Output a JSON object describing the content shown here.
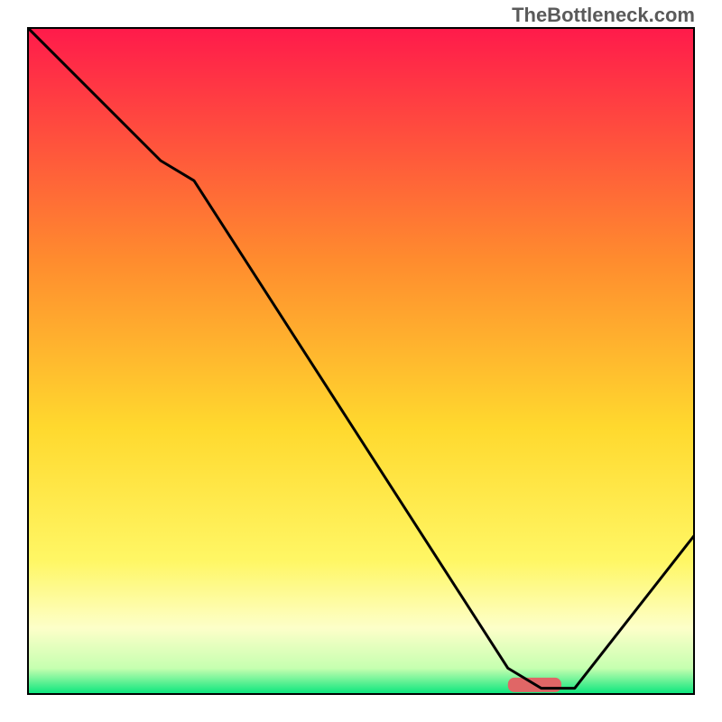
{
  "watermark": "TheBottleneck.com",
  "colors": {
    "top": "#ff1a4b",
    "mid_upper": "#ff8c2e",
    "mid": "#ffd92e",
    "mid_lower": "#fff765",
    "pale": "#fdffc9",
    "green_light": "#c6ffb0",
    "green": "#00e47a",
    "curve": "#000000",
    "marker": "#e06666",
    "border": "#000000"
  },
  "chart_data": {
    "type": "line",
    "title": "",
    "xlabel": "",
    "ylabel": "",
    "xlim": [
      0,
      100
    ],
    "ylim": [
      0,
      100
    ],
    "x": [
      0,
      20,
      25,
      72,
      77,
      82,
      100
    ],
    "values": [
      100,
      80,
      77,
      4,
      1,
      1,
      24
    ],
    "marker": {
      "x_range": [
        72,
        80
      ],
      "y": 1.5
    },
    "annotations": []
  }
}
